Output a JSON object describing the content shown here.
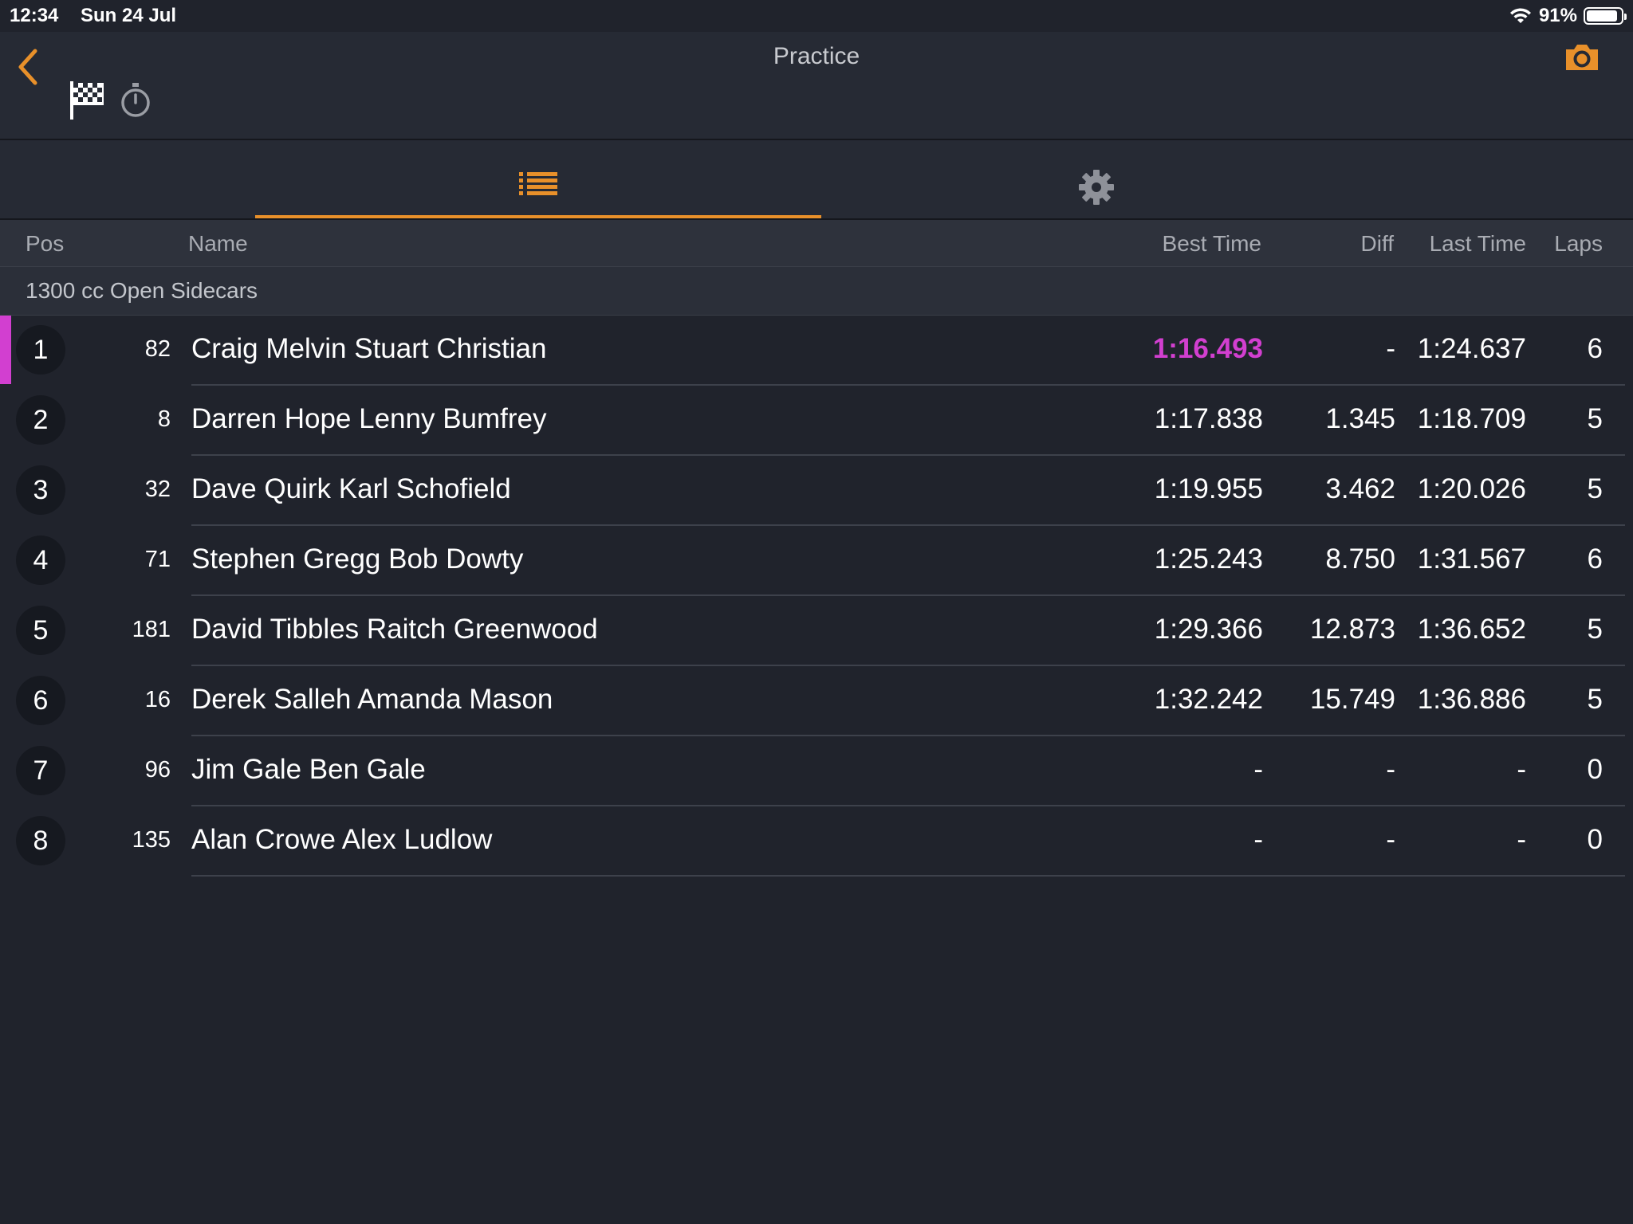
{
  "status_bar": {
    "time": "12:34",
    "date": "Sun 24 Jul",
    "battery": "91%",
    "battery_level": 0.91
  },
  "header": {
    "title": "Practice"
  },
  "icons": [
    "back-chevron-icon",
    "checkered-flag-icon",
    "stopwatch-icon",
    "camera-icon",
    "list-icon",
    "gear-icon",
    "wifi-icon",
    "battery-icon"
  ],
  "colors": {
    "accent": "#e8902a",
    "fastest": "#d23fd0",
    "background": "#20232c"
  },
  "tabs": {
    "active": "list",
    "items": [
      "list",
      "settings"
    ]
  },
  "columns": {
    "pos": "Pos",
    "name": "Name",
    "best": "Best Time",
    "diff": "Diff",
    "last": "Last Time",
    "laps": "Laps"
  },
  "group": {
    "title": "1300 cc Open Sidecars"
  },
  "results": [
    {
      "pos": "1",
      "number": "82",
      "name": "Craig Melvin Stuart Christian",
      "best": "1:16.493",
      "diff": "-",
      "last": "1:24.637",
      "laps": "6",
      "fastest": true
    },
    {
      "pos": "2",
      "number": "8",
      "name": "Darren Hope Lenny Bumfrey",
      "best": "1:17.838",
      "diff": "1.345",
      "last": "1:18.709",
      "laps": "5"
    },
    {
      "pos": "3",
      "number": "32",
      "name": "Dave Quirk Karl Schofield",
      "best": "1:19.955",
      "diff": "3.462",
      "last": "1:20.026",
      "laps": "5"
    },
    {
      "pos": "4",
      "number": "71",
      "name": "Stephen Gregg Bob Dowty",
      "best": "1:25.243",
      "diff": "8.750",
      "last": "1:31.567",
      "laps": "6"
    },
    {
      "pos": "5",
      "number": "181",
      "name": "David Tibbles Raitch Greenwood",
      "best": "1:29.366",
      "diff": "12.873",
      "last": "1:36.652",
      "laps": "5"
    },
    {
      "pos": "6",
      "number": "16",
      "name": "Derek Salleh Amanda Mason",
      "best": "1:32.242",
      "diff": "15.749",
      "last": "1:36.886",
      "laps": "5"
    },
    {
      "pos": "7",
      "number": "96",
      "name": "Jim Gale Ben Gale",
      "best": "-",
      "diff": "-",
      "last": "-",
      "laps": "0"
    },
    {
      "pos": "8",
      "number": "135",
      "name": "Alan Crowe Alex Ludlow",
      "best": "-",
      "diff": "-",
      "last": "-",
      "laps": "0"
    }
  ]
}
